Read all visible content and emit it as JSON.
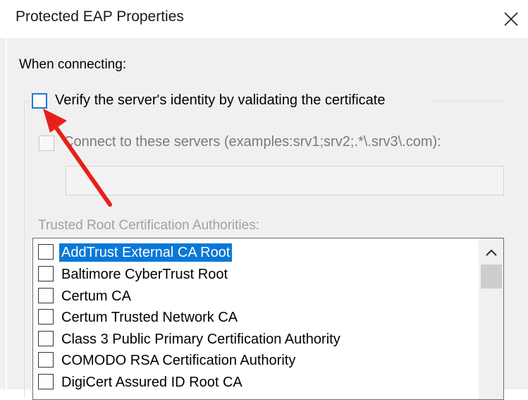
{
  "window": {
    "title": "Protected EAP Properties",
    "close_icon": "close-icon"
  },
  "when_connecting": "When connecting:",
  "verify": {
    "label": "Verify the server's identity by validating the certificate",
    "checked": false
  },
  "connect": {
    "label": "Connect to these servers (examples:srv1;srv2;.*\\.srv3\\.com):",
    "checked": false,
    "value": ""
  },
  "trusted_label": "Trusted Root Certification Authorities:",
  "authorities": [
    {
      "label": "AddTrust External CA Root",
      "checked": false,
      "selected": true
    },
    {
      "label": "Baltimore CyberTrust Root",
      "checked": false,
      "selected": false
    },
    {
      "label": "Certum CA",
      "checked": false,
      "selected": false
    },
    {
      "label": "Certum Trusted Network CA",
      "checked": false,
      "selected": false
    },
    {
      "label": "Class 3 Public Primary Certification Authority",
      "checked": false,
      "selected": false
    },
    {
      "label": "COMODO RSA Certification Authority",
      "checked": false,
      "selected": false
    },
    {
      "label": "DigiCert Assured ID Root CA",
      "checked": false,
      "selected": false
    }
  ],
  "colors": {
    "selection": "#0a78d7",
    "focus": "#1e78d6",
    "annotation_arrow": "#e8201c"
  }
}
